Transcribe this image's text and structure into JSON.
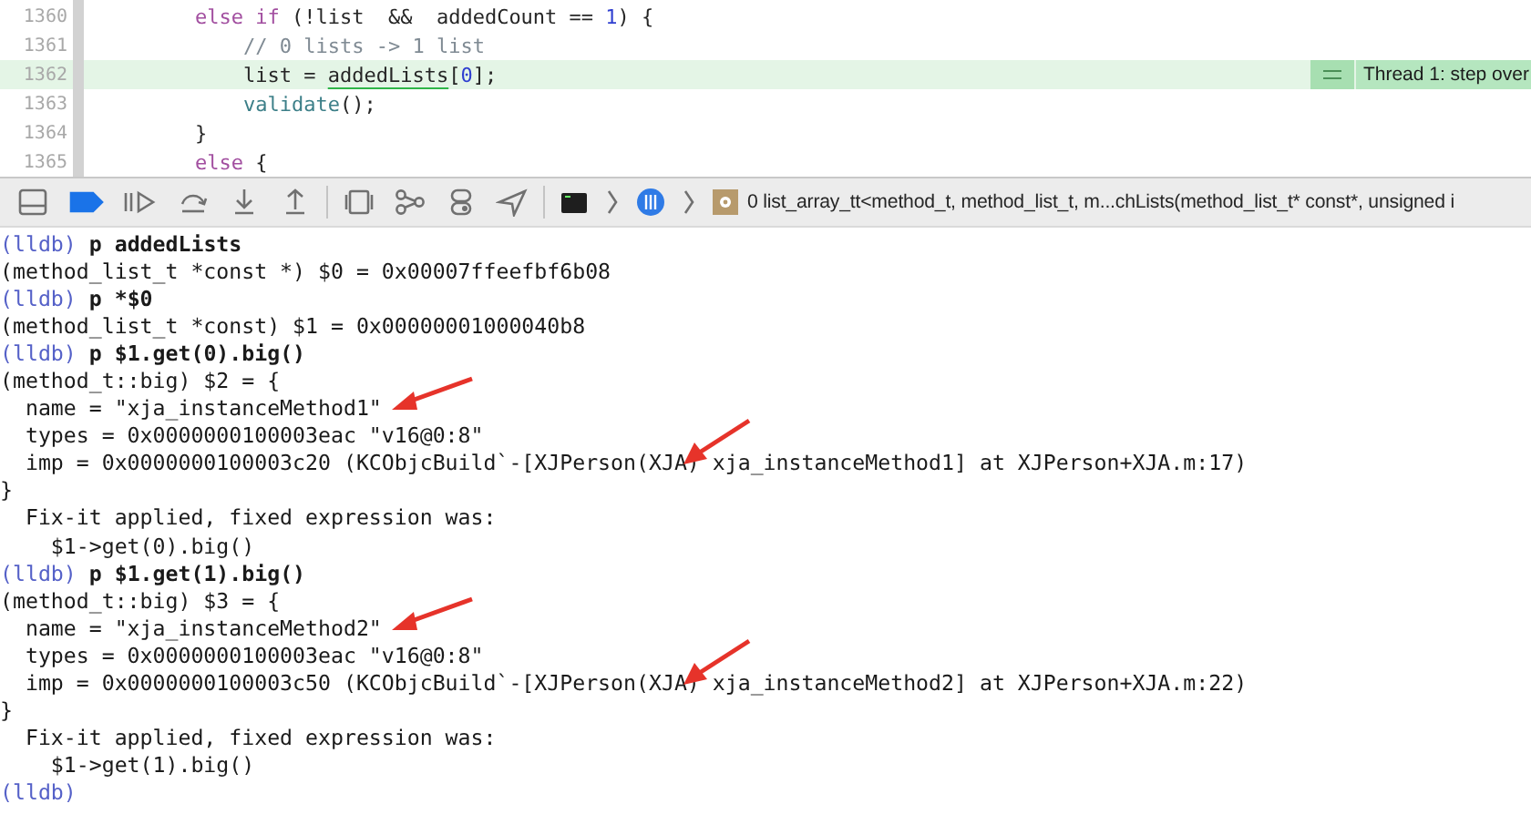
{
  "editor": {
    "lines": [
      {
        "number": "1360",
        "selected": false,
        "tokens": [
          {
            "kind": "keyword",
            "text": "else if"
          },
          {
            "kind": "plain",
            "text": " (!list  &&  addedCount == "
          },
          {
            "kind": "number",
            "text": "1"
          },
          {
            "kind": "plain",
            "text": ") {"
          }
        ]
      },
      {
        "number": "1361",
        "selected": false,
        "tokens": [
          {
            "kind": "comment",
            "text": "    // 0 lists -> 1 list"
          }
        ]
      },
      {
        "number": "1362",
        "selected": true,
        "annotation": "Thread 1: step over",
        "tokens": [
          {
            "kind": "plain",
            "text": "    list = "
          },
          {
            "kind": "underlined",
            "text": "addedLists"
          },
          {
            "kind": "plain",
            "text": "["
          },
          {
            "kind": "number",
            "text": "0"
          },
          {
            "kind": "plain",
            "text": "];"
          }
        ]
      },
      {
        "number": "1363",
        "selected": false,
        "tokens": [
          {
            "kind": "function",
            "text": "    validate"
          },
          {
            "kind": "plain",
            "text": "();"
          }
        ]
      },
      {
        "number": "1364",
        "selected": false,
        "tokens": [
          {
            "kind": "plain",
            "text": "}"
          }
        ]
      },
      {
        "number": "1365",
        "selected": false,
        "tokens": [
          {
            "kind": "keyword",
            "text": "else"
          },
          {
            "kind": "plain",
            "text": " {"
          }
        ]
      }
    ]
  },
  "debug_bar": {
    "breakpoints_active": true,
    "frame": "0 list_array_tt<method_t, method_list_t, m...chLists(method_list_t* const*, unsigned i"
  },
  "console": {
    "lines": [
      {
        "kind": "command",
        "prompt": "(lldb)",
        "text": "p addedLists"
      },
      {
        "kind": "output",
        "text": "(method_list_t *const *) $0 = 0x00007ffeefbf6b08"
      },
      {
        "kind": "command",
        "prompt": "(lldb)",
        "text": "p *$0"
      },
      {
        "kind": "output",
        "text": "(method_list_t *const) $1 = 0x00000001000040b8"
      },
      {
        "kind": "command",
        "prompt": "(lldb)",
        "text": "p $1.get(0).big()"
      },
      {
        "kind": "output",
        "text": "(method_t::big) $2 = {"
      },
      {
        "kind": "output",
        "text": "  name = \"xja_instanceMethod1\"",
        "arrow": true,
        "arrow_down": false
      },
      {
        "kind": "output",
        "text": "  types = 0x0000000100003eac \"v16@0:8\"",
        "arrow": true,
        "arrow_down": true
      },
      {
        "kind": "output",
        "text": "  imp = 0x0000000100003c20 (KCObjcBuild`-[XJPerson(XJA) xja_instanceMethod1] at XJPerson+XJA.m:17)"
      },
      {
        "kind": "output",
        "text": "}"
      },
      {
        "kind": "output",
        "text": "  Fix-it applied, fixed expression was: "
      },
      {
        "kind": "output",
        "text": "    $1->get(0).big()"
      },
      {
        "kind": "command",
        "prompt": "(lldb)",
        "text": "p $1.get(1).big()"
      },
      {
        "kind": "output",
        "text": "(method_t::big) $3 = {"
      },
      {
        "kind": "output",
        "text": "  name = \"xja_instanceMethod2\"",
        "arrow": true,
        "arrow_down": false
      },
      {
        "kind": "output",
        "text": "  types = 0x0000000100003eac \"v16@0:8\"",
        "arrow": true,
        "arrow_down": true
      },
      {
        "kind": "output",
        "text": "  imp = 0x0000000100003c50 (KCObjcBuild`-[XJPerson(XJA) xja_instanceMethod2] at XJPerson+XJA.m:22)"
      },
      {
        "kind": "output",
        "text": "}"
      },
      {
        "kind": "output",
        "text": "  Fix-it applied, fixed expression was: "
      },
      {
        "kind": "output",
        "text": "    $1->get(1).big()"
      },
      {
        "kind": "command",
        "prompt": "(lldb)"
      }
    ]
  }
}
